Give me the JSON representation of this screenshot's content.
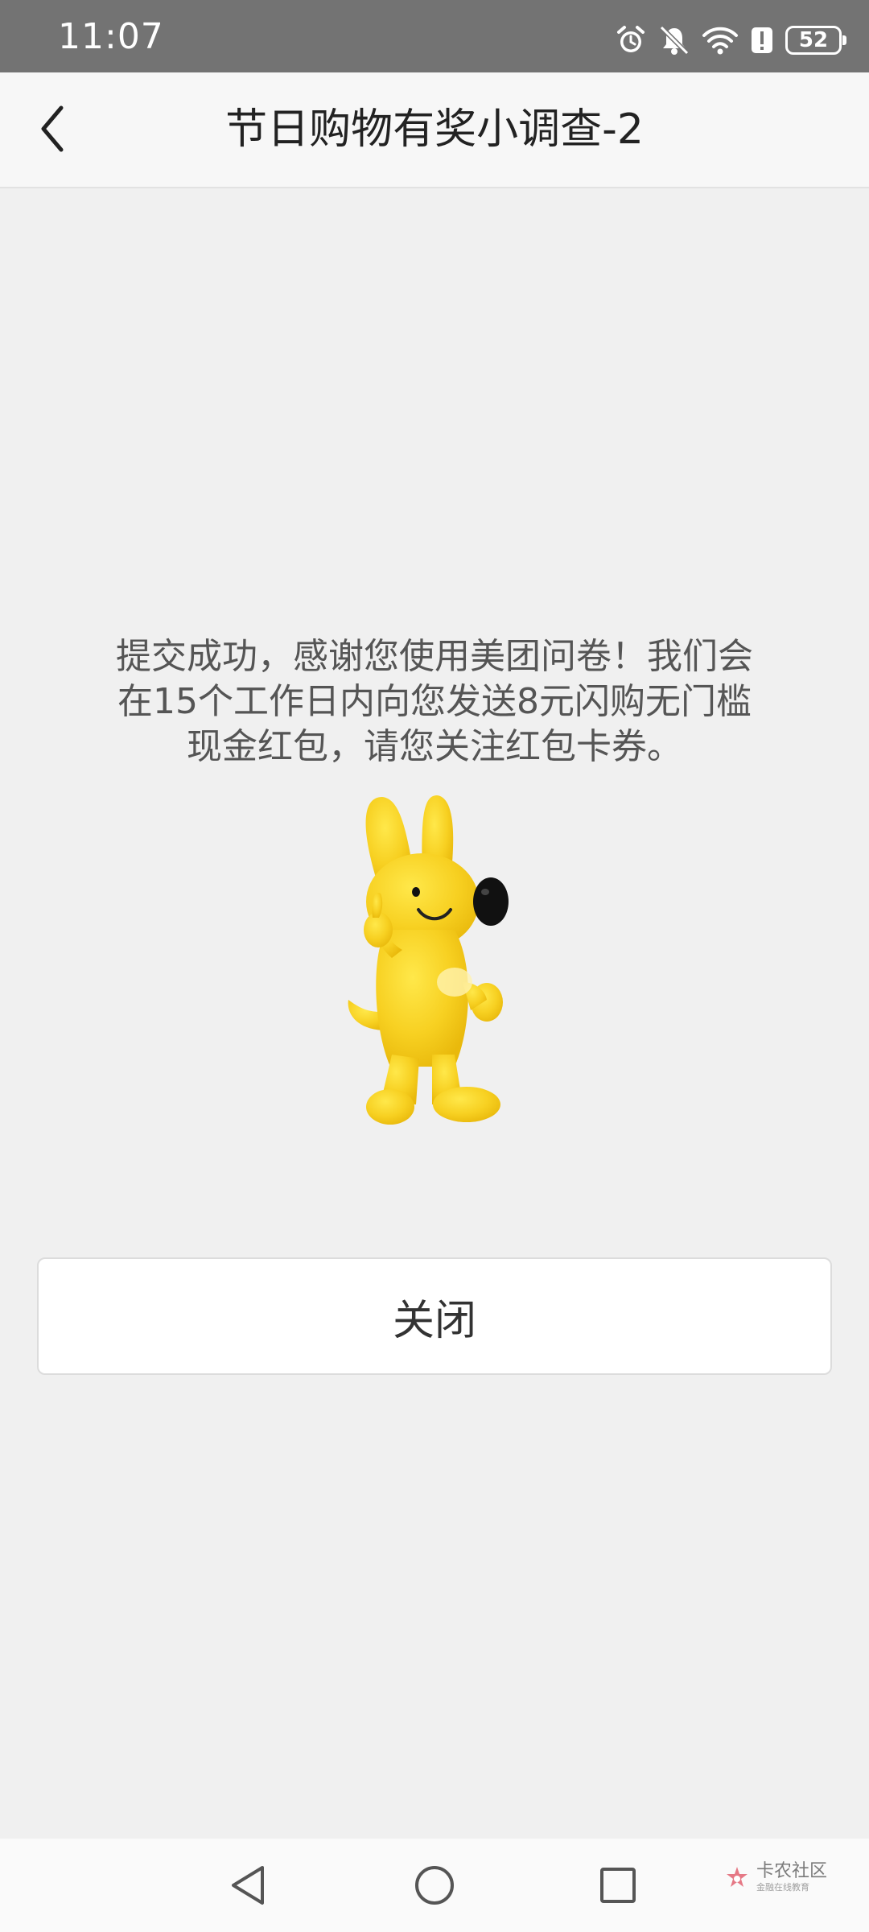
{
  "status_bar": {
    "time": "11:07",
    "battery_level": "52",
    "icons": [
      "alarm-icon",
      "mute-notifications-icon",
      "wifi-icon",
      "alert-icon",
      "battery-icon"
    ]
  },
  "header": {
    "title": "节日购物有奖小调查-2",
    "back_icon": "chevron-left-icon"
  },
  "main": {
    "message_lines": [
      "提交成功，感谢您使用美团问卷！我们会",
      "在15个工作日内向您发送8元闪购无门槛",
      "现金红包，请您关注红包卡券。"
    ],
    "mascot": "yellow-kangaroo-mascot",
    "close_label": "关闭"
  },
  "nav_bar": {
    "buttons": [
      "back-triangle-icon",
      "home-circle-icon",
      "recents-square-icon"
    ]
  },
  "watermark": {
    "text": "卡农社区",
    "subtext": "金融在线教育"
  },
  "colors": {
    "status_bar_bg": "#737373",
    "page_bg": "#f0f0f0",
    "header_bg": "#f7f7f7",
    "mascot_yellow": "#f7d021"
  }
}
